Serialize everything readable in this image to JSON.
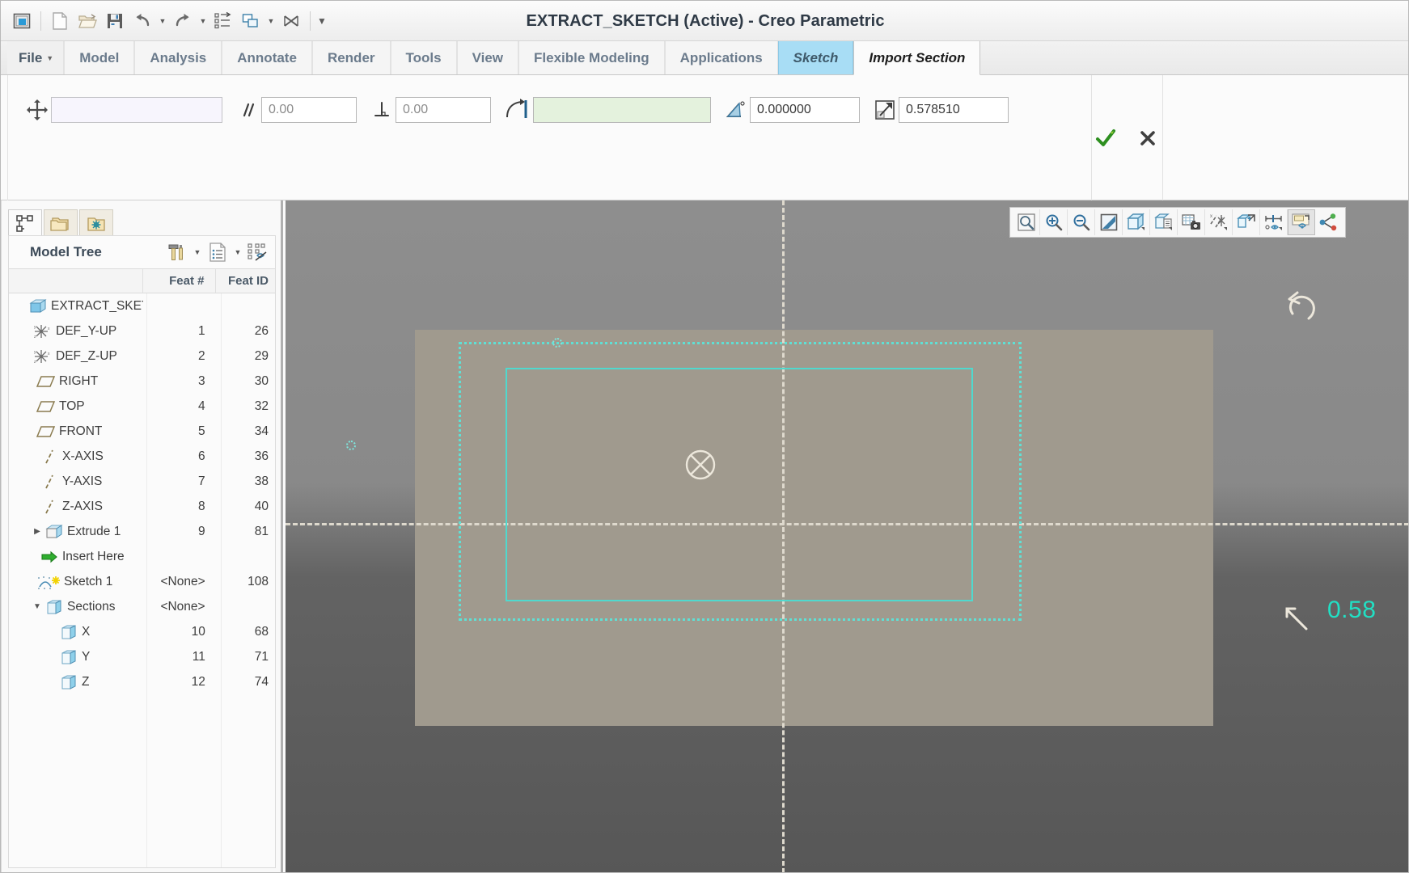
{
  "window": {
    "title": "EXTRACT_SKETCH (Active) - Creo Parametric"
  },
  "quick_access": {
    "buttons": [
      {
        "name": "window-icon",
        "tooltip": "Window"
      },
      {
        "name": "new-icon",
        "tooltip": "New"
      },
      {
        "name": "open-icon",
        "tooltip": "Open"
      },
      {
        "name": "save-icon",
        "tooltip": "Save"
      },
      {
        "name": "undo-icon",
        "tooltip": "Undo"
      },
      {
        "name": "redo-icon",
        "tooltip": "Redo"
      },
      {
        "name": "regenerate-icon",
        "tooltip": "Regenerate"
      },
      {
        "name": "window-switch-icon",
        "tooltip": "Window"
      },
      {
        "name": "close-window-icon",
        "tooltip": "Close"
      }
    ]
  },
  "ribbon": {
    "tabs": [
      {
        "id": "file",
        "label": "File",
        "state": "file"
      },
      {
        "id": "model",
        "label": "Model",
        "state": "normal"
      },
      {
        "id": "analysis",
        "label": "Analysis",
        "state": "normal"
      },
      {
        "id": "annotate",
        "label": "Annotate",
        "state": "normal"
      },
      {
        "id": "render",
        "label": "Render",
        "state": "normal"
      },
      {
        "id": "tools",
        "label": "Tools",
        "state": "normal"
      },
      {
        "id": "view",
        "label": "View",
        "state": "normal"
      },
      {
        "id": "flexmod",
        "label": "Flexible Modeling",
        "state": "normal"
      },
      {
        "id": "apps",
        "label": "Applications",
        "state": "normal"
      },
      {
        "id": "sketch",
        "label": "Sketch",
        "state": "highlight"
      },
      {
        "id": "importsect",
        "label": "Import Section",
        "state": "active"
      }
    ]
  },
  "dashboard": {
    "fields": [
      {
        "id": "reference",
        "icon": "move-reference-icon",
        "value": "",
        "placeholder": ""
      },
      {
        "id": "parallel",
        "icon": "parallel-icon",
        "value": "",
        "placeholder": "0.00"
      },
      {
        "id": "perpendicular",
        "icon": "perpendicular-icon",
        "value": "",
        "placeholder": "0.00"
      },
      {
        "id": "rotate_ref",
        "icon": "rotate-reference-icon",
        "value": "",
        "placeholder": ""
      },
      {
        "id": "angle",
        "icon": "angle-icon",
        "value": "0.000000",
        "placeholder": ""
      },
      {
        "id": "scale",
        "icon": "scale-icon",
        "value": "0.578510",
        "placeholder": ""
      }
    ],
    "accept_label": "OK",
    "cancel_label": "Cancel"
  },
  "navigator": {
    "tabs": [
      {
        "id": "model-tree",
        "icon": "model-tree-icon",
        "selected": true
      },
      {
        "id": "folder-browser",
        "icon": "folder-browser-icon",
        "selected": false
      },
      {
        "id": "favorites",
        "icon": "favorites-folder-icon",
        "selected": false
      }
    ],
    "title": "Model Tree",
    "tools": [
      {
        "id": "settings",
        "icon": "tools-icon",
        "has_caret": true
      },
      {
        "id": "display",
        "icon": "document-list-icon",
        "has_caret": true
      },
      {
        "id": "tree-filter",
        "icon": "tree-filter-off-icon",
        "has_caret": false
      }
    ],
    "columns": [
      "",
      "Feat #",
      "Feat ID"
    ],
    "rows": [
      {
        "name": "EXTRACT_SKETC",
        "feat": "",
        "id": "",
        "icon": "part-icon",
        "indent": 0,
        "expander": "none"
      },
      {
        "name": "DEF_Y-UP",
        "feat": "1",
        "id": "26",
        "icon": "csys-icon",
        "indent": 1,
        "expander": "none"
      },
      {
        "name": "DEF_Z-UP",
        "feat": "2",
        "id": "29",
        "icon": "csys-icon",
        "indent": 1,
        "expander": "none"
      },
      {
        "name": "RIGHT",
        "feat": "3",
        "id": "30",
        "icon": "datum-plane-icon",
        "indent": 1,
        "expander": "none"
      },
      {
        "name": "TOP",
        "feat": "4",
        "id": "32",
        "icon": "datum-plane-icon",
        "indent": 1,
        "expander": "none"
      },
      {
        "name": "FRONT",
        "feat": "5",
        "id": "34",
        "icon": "datum-plane-icon",
        "indent": 1,
        "expander": "none"
      },
      {
        "name": "X-AXIS",
        "feat": "6",
        "id": "36",
        "icon": "datum-axis-icon",
        "indent": 1,
        "expander": "none"
      },
      {
        "name": "Y-AXIS",
        "feat": "7",
        "id": "38",
        "icon": "datum-axis-icon",
        "indent": 1,
        "expander": "none"
      },
      {
        "name": "Z-AXIS",
        "feat": "8",
        "id": "40",
        "icon": "datum-axis-icon",
        "indent": 1,
        "expander": "none"
      },
      {
        "name": "Extrude 1",
        "feat": "9",
        "id": "81",
        "icon": "extrude-icon",
        "indent": 1,
        "expander": "collapsed"
      },
      {
        "name": "Insert Here",
        "feat": "",
        "id": "",
        "icon": "insert-here-icon",
        "indent": 1,
        "expander": "none"
      },
      {
        "name": "Sketch 1",
        "feat": "<None>",
        "id": "108",
        "icon": "sketch-icon",
        "indent": 1,
        "expander": "none"
      },
      {
        "name": "Sections",
        "feat": "<None>",
        "id": "",
        "icon": "sections-icon",
        "indent": 1,
        "expander": "expanded"
      },
      {
        "name": "X",
        "feat": "10",
        "id": "68",
        "icon": "section-icon",
        "indent": 2,
        "expander": "none"
      },
      {
        "name": "Y",
        "feat": "11",
        "id": "71",
        "icon": "section-icon",
        "indent": 2,
        "expander": "none"
      },
      {
        "name": "Z",
        "feat": "12",
        "id": "74",
        "icon": "section-icon",
        "indent": 2,
        "expander": "none"
      }
    ]
  },
  "graphics_toolbar": {
    "buttons": [
      {
        "id": "refit",
        "icon": "zoom-fit-icon",
        "pressed": false
      },
      {
        "id": "zoom-in",
        "icon": "zoom-in-icon",
        "pressed": false
      },
      {
        "id": "zoom-out",
        "icon": "zoom-out-icon",
        "pressed": false
      },
      {
        "id": "repaint",
        "icon": "repaint-icon",
        "pressed": false
      },
      {
        "id": "display-style",
        "icon": "display-style-icon",
        "pressed": false
      },
      {
        "id": "saved-views",
        "icon": "saved-views-icon",
        "pressed": false
      },
      {
        "id": "view-manager",
        "icon": "view-manager-icon",
        "pressed": false
      },
      {
        "id": "datum-display",
        "icon": "datum-display-icon",
        "pressed": false
      },
      {
        "id": "layers",
        "icon": "layers-icon",
        "pressed": false
      },
      {
        "id": "annot-display",
        "icon": "annotation-display-icon",
        "pressed": false
      },
      {
        "id": "spin-center",
        "icon": "spin-center-icon",
        "pressed": true
      },
      {
        "id": "appearance",
        "icon": "appearance-gallery-icon",
        "pressed": false
      }
    ]
  },
  "viewport": {
    "dimension_label": "0.58",
    "colors": {
      "background_top": "#8e8e8e",
      "background_bottom": "#575757",
      "plate": "#a09a8e",
      "section_cyan": "#4fd9ce",
      "dimension_cyan": "#21e0c4",
      "reference_line": "#ded9cd"
    },
    "handles": [
      {
        "id": "rotate-handle",
        "name": "rotate-handle-icon"
      },
      {
        "id": "scale-handle",
        "name": "scale-handle-icon"
      },
      {
        "id": "origin-marker",
        "name": "origin-marker-icon"
      }
    ]
  }
}
